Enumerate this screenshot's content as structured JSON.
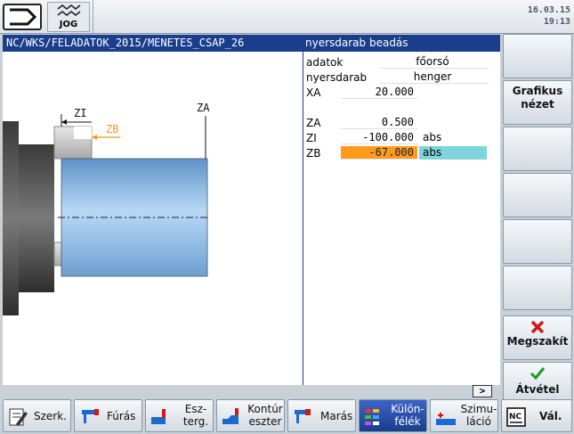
{
  "header": {
    "mode_label": "JOG",
    "date": "16.03.15",
    "time": "19:13",
    "path": "NC/WKS/FELADATOK_2015/MENETES_CSAP_26",
    "dialog_title": "nyersdarab beadás"
  },
  "form": {
    "adatok_label": "adatok",
    "adatok_value": "főorsó",
    "nyersdarab_label": "nyersdarab",
    "nyersdarab_value": "henger",
    "xa_label": "XA",
    "xa_value": "20.000",
    "za_label": "ZA",
    "za_value": "0.500",
    "zi_label": "ZI",
    "zi_value": "-100.000",
    "zi_unit": "abs",
    "zb_label": "ZB",
    "zb_value": "-67.000",
    "zb_unit": "abs"
  },
  "graphic": {
    "zi_label": "ZI",
    "zb_label": "ZB",
    "za_label": "ZA"
  },
  "right_softkeys": {
    "grafikus_line1": "Grafikus",
    "grafikus_line2": "nézet",
    "megszakit": "Megszakít",
    "atvetel": "Átvétel"
  },
  "bottom_softkeys": {
    "szerk": "Szerk.",
    "furas": "Fúrás",
    "eszterg_line1": "Esz-",
    "eszterg_line2": "terg.",
    "kontur_line1": "Kontúr",
    "kontur_line2": "eszter",
    "maras": "Marás",
    "kulonfelek_line1": "Külön-",
    "kulonfelek_line2": "félék",
    "szimulacio_line1": "Szimu-",
    "szimulacio_line2": "láció",
    "val": "Vál.",
    "more_arrow": ">"
  },
  "colors": {
    "title_bg": "#1a3e8c",
    "active_field": "#ff9a1a",
    "unit_highlight": "#7fd4dc",
    "part_blue": "#8fc0ee"
  }
}
